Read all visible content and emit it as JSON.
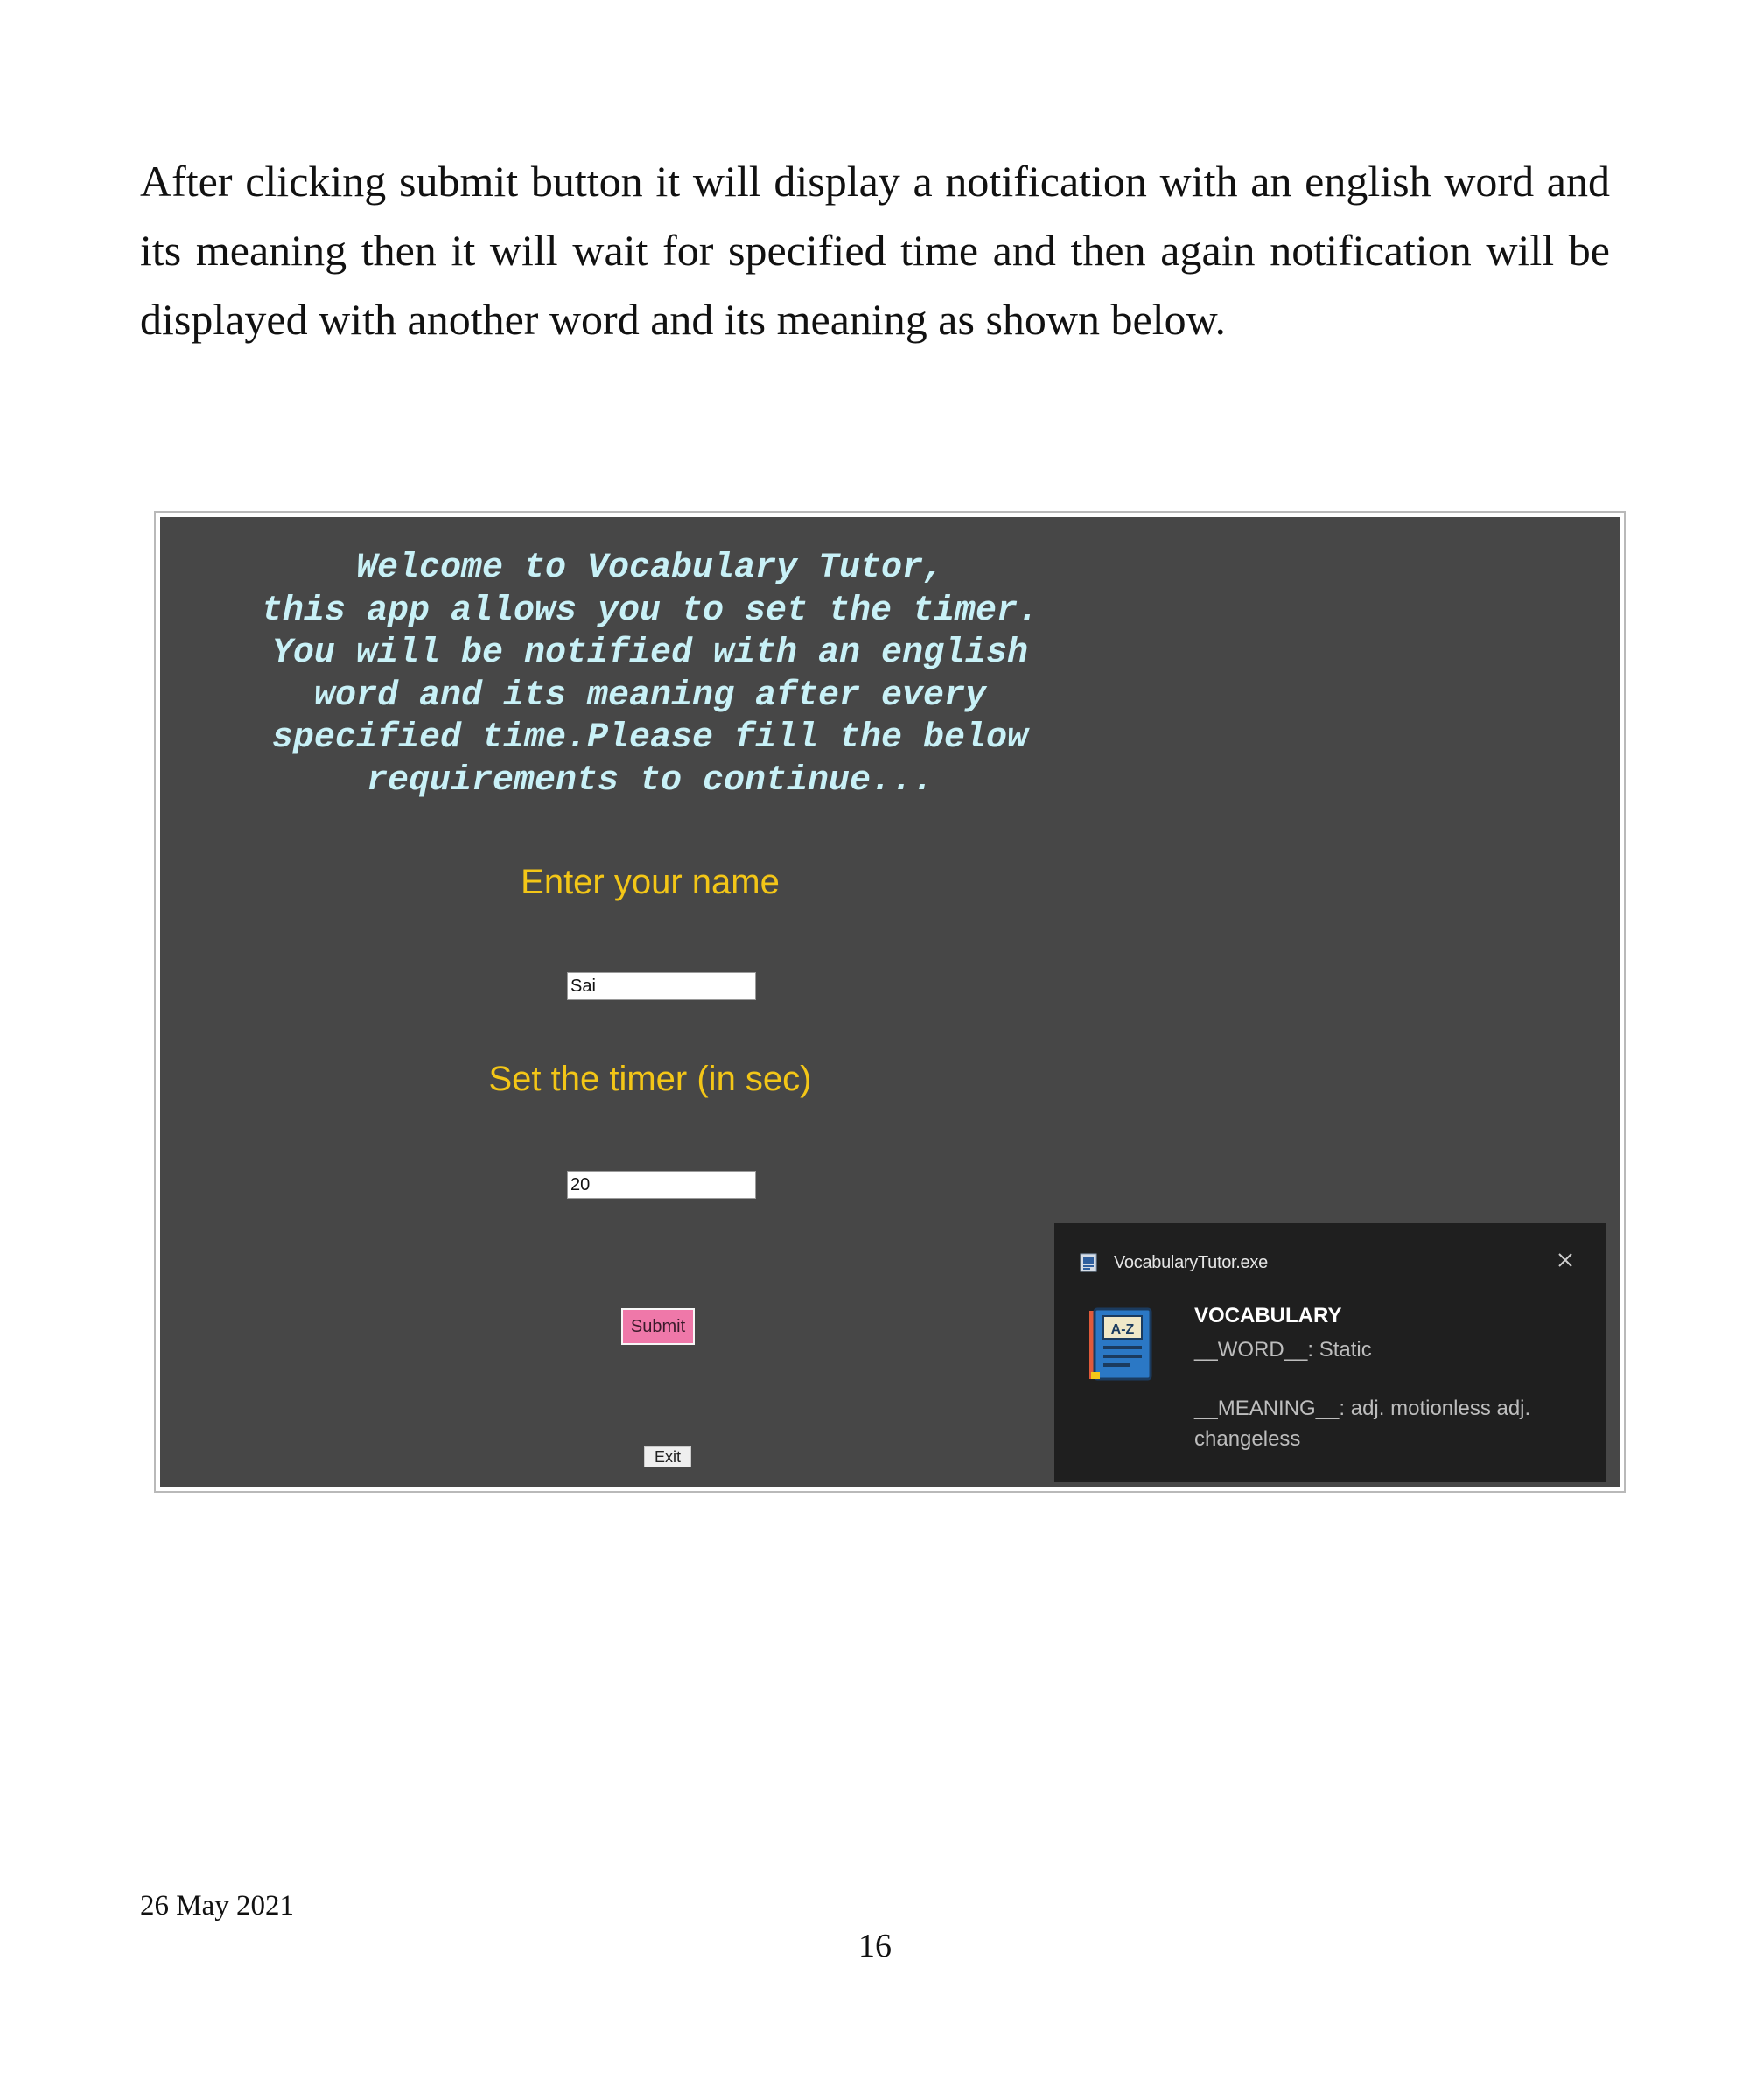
{
  "paragraph": "After clicking submit button it will display a notification with an english word and its meaning then it will wait for specified time and then again notification will be displayed with another word and its meaning as shown below.",
  "app": {
    "welcome_lines": [
      "Welcome to Vocabulary Tutor,",
      "this app allows you to set the timer.",
      "You will be notified with an english",
      "word and its meaning after every",
      "specified time.Please fill the below",
      "requirements to continue..."
    ],
    "name_label": "Enter your name",
    "name_value": "Sai",
    "timer_label": "Set the timer (in sec)",
    "timer_value": "20",
    "submit_label": "Submit",
    "exit_label": "Exit",
    "colors": {
      "background": "#474747",
      "welcome_text": "#c8f1f7",
      "labels": "#f3c617",
      "submit": "#ef78a9"
    }
  },
  "notification": {
    "app_name": "VocabularyTutor.exe",
    "app_icon": "app-icon",
    "close_icon": "close-icon",
    "body_icon": "a-z-dictionary-icon",
    "title": "VOCABULARY",
    "word_line": "__WORD__:  Static",
    "meaning_line": "__MEANING__:  adj. motionless adj. changeless",
    "background": "#1f1f1f"
  },
  "footer": {
    "date": "26 May 2021",
    "page_number": "16"
  }
}
